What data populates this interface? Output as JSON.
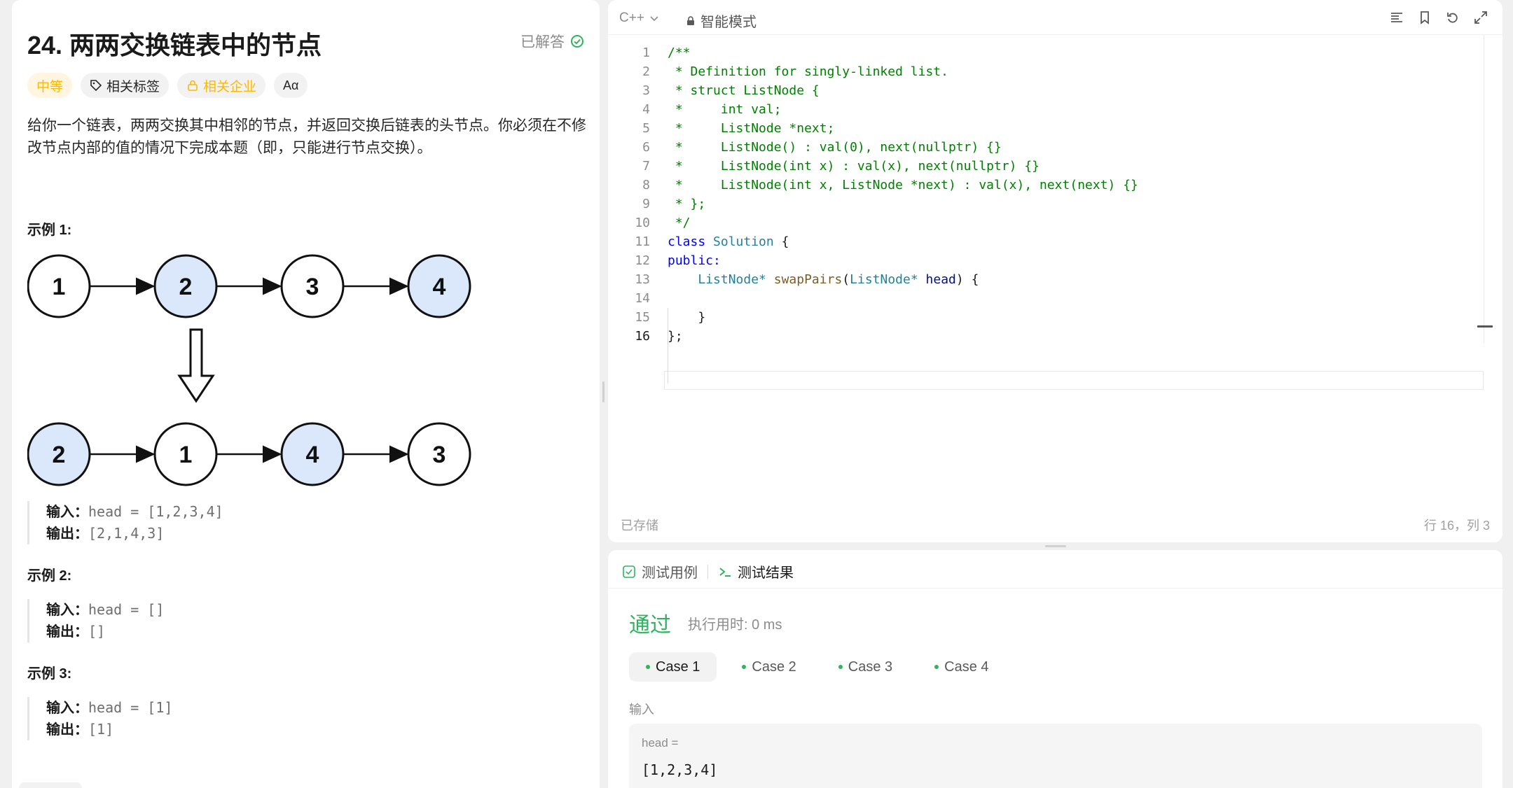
{
  "problem": {
    "title": "24. 两两交换链表中的节点",
    "solved_label": "已解答",
    "tags": {
      "difficulty": "中等",
      "related_tags": "相关标签",
      "related_companies": "相关企业",
      "font_icon": "Aα"
    },
    "description": "给你一个链表，两两交换其中相邻的节点，并返回交换后链表的头节点。你必须在不修改节点内部的值的情况下完成本题（即，只能进行节点交换）。",
    "diagram": {
      "top_row": [
        "1",
        "2",
        "3",
        "4"
      ],
      "bottom_row": [
        "2",
        "1",
        "4",
        "3"
      ]
    },
    "examples": [
      {
        "title": "示例 1:",
        "input_label": "输入：",
        "input": "head = [1,2,3,4]",
        "output_label": "输出：",
        "output": "[2,1,4,3]"
      },
      {
        "title": "示例 2:",
        "input_label": "输入：",
        "input": "head = []",
        "output_label": "输出：",
        "output": "[]"
      },
      {
        "title": "示例 3:",
        "input_label": "输入：",
        "input": "head = [1]",
        "output_label": "输出：",
        "output": "[1]"
      }
    ]
  },
  "editor": {
    "language": "C++",
    "mode": "智能模式",
    "status_saved": "已存储",
    "cursor_position": "行 16，列 3",
    "line_numbers": [
      "1",
      "2",
      "3",
      "4",
      "5",
      "6",
      "7",
      "8",
      "9",
      "10",
      "11",
      "12",
      "13",
      "14",
      "15",
      "16"
    ],
    "code": {
      "l1": "/**",
      "l2": " * Definition for singly-linked list.",
      "l3": " * struct ListNode {",
      "l4": " *     int val;",
      "l5": " *     ListNode *next;",
      "l6": " *     ListNode() : val(0), next(nullptr) {}",
      "l7": " *     ListNode(int x) : val(x), next(nullptr) {}",
      "l8": " *     ListNode(int x, ListNode *next) : val(x), next(next) {}",
      "l9": " * };",
      "l10": " */",
      "l11_kw": "class",
      "l11_ty": "Solution",
      "l11_rest": " {",
      "l12": "public:",
      "l13_ty1": "ListNode*",
      "l13_fn": "swapPairs",
      "l13_p1": "(",
      "l13_ty2": "ListNode*",
      "l13_vr": "head",
      "l13_rest": ") {",
      "l15": "}",
      "l16": "};"
    }
  },
  "result": {
    "tab_testcase": "测试用例",
    "tab_result": "测试结果",
    "status": "通过",
    "runtime": "执行用时: 0 ms",
    "cases": [
      "Case 1",
      "Case 2",
      "Case 3",
      "Case 4"
    ],
    "input_label": "输入",
    "input_name": "head =",
    "input_value": "[1,2,3,4]"
  },
  "colors": {
    "accent_green": "#2db55d",
    "difficulty_orange": "#ffb800",
    "node_highlight": "#dbe8fb"
  }
}
